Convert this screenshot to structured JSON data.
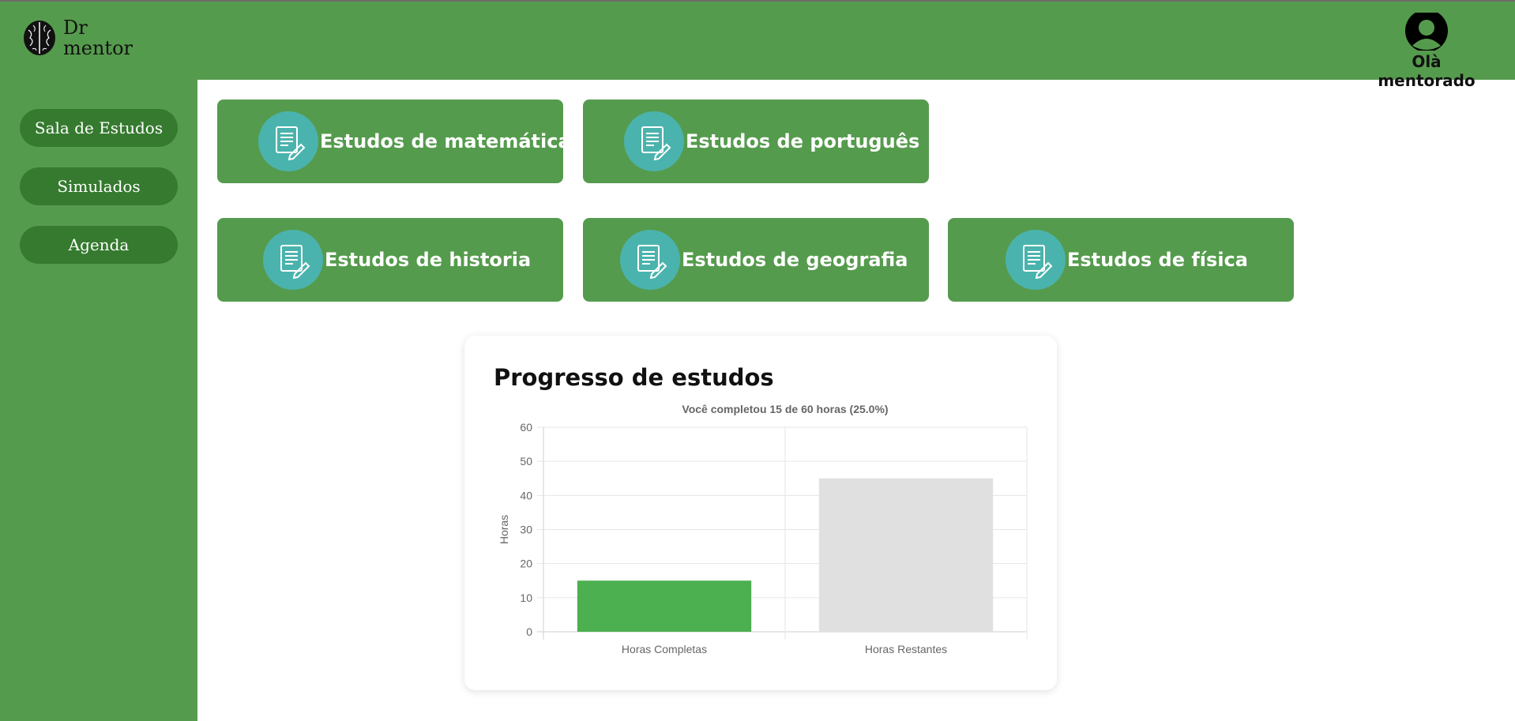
{
  "brand": {
    "name_line1": "Dr",
    "name_line2": "mentor",
    "logo_icon": "brain-icon"
  },
  "user": {
    "greeting": "Olà mentorado",
    "avatar_icon": "user-avatar-icon"
  },
  "sidebar": {
    "items": [
      {
        "label": "Sala de Estudos"
      },
      {
        "label": "Simulados"
      },
      {
        "label": "Agenda"
      }
    ]
  },
  "cards": [
    {
      "title": "Estudos de matemática",
      "icon": "document-edit-icon"
    },
    {
      "title": "Estudos de português",
      "icon": "document-edit-icon"
    },
    {
      "title": "Estudos de historia",
      "icon": "document-edit-icon"
    },
    {
      "title": "Estudos de geografia",
      "icon": "document-edit-icon"
    },
    {
      "title": "Estudos de física",
      "icon": "document-edit-icon"
    }
  ],
  "colors": {
    "brand_green": "#559b4d",
    "button_green": "#357a2f",
    "icon_teal": "#4bb3ad",
    "completed_bar": "#4caf50",
    "remaining_bar": "#e0e0e0"
  },
  "chart_section": {
    "title": "Progresso de estudos"
  },
  "chart_data": {
    "type": "bar",
    "title": "Você completou 15 de 60 horas (25.0%)",
    "categories": [
      "Horas Completas",
      "Horas Restantes"
    ],
    "values": [
      15,
      45
    ],
    "xlabel": "",
    "ylabel": "Horas",
    "ylim": [
      0,
      60
    ],
    "yticks": [
      0,
      10,
      20,
      30,
      40,
      50,
      60
    ],
    "grid": true,
    "legend": "none"
  }
}
